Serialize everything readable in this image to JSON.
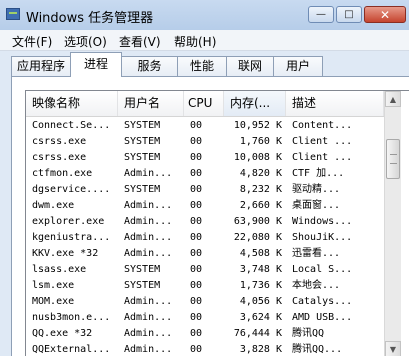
{
  "window": {
    "title": "Windows 任务管理器",
    "buttons": {
      "minimize": "—",
      "maximize": "□",
      "close": "✕"
    }
  },
  "menu": [
    "文件(F)",
    "选项(O)",
    "查看(V)",
    "帮助(H)"
  ],
  "tabs": [
    "应用程序",
    "进程",
    "服务",
    "性能",
    "联网",
    "用户"
  ],
  "active_tab": "进程",
  "columns": [
    "映像名称",
    "用户名",
    "CPU",
    "内存(...",
    "描述"
  ],
  "processes": [
    {
      "name": "Connect.Se...",
      "user": "SYSTEM",
      "cpu": "00",
      "mem": "10,952 K",
      "desc": "Content..."
    },
    {
      "name": "csrss.exe",
      "user": "SYSTEM",
      "cpu": "00",
      "mem": "1,760 K",
      "desc": "Client ..."
    },
    {
      "name": "csrss.exe",
      "user": "SYSTEM",
      "cpu": "00",
      "mem": "10,008 K",
      "desc": "Client ..."
    },
    {
      "name": "ctfmon.exe",
      "user": "Admin...",
      "cpu": "00",
      "mem": "4,820 K",
      "desc": "CTF 加..."
    },
    {
      "name": "dgservice....",
      "user": "SYSTEM",
      "cpu": "00",
      "mem": "8,232 K",
      "desc": "驱动精..."
    },
    {
      "name": "dwm.exe",
      "user": "Admin...",
      "cpu": "00",
      "mem": "2,660 K",
      "desc": "桌面窗..."
    },
    {
      "name": "explorer.exe",
      "user": "Admin...",
      "cpu": "00",
      "mem": "63,900 K",
      "desc": "Windows..."
    },
    {
      "name": "kgeniustra...",
      "user": "Admin...",
      "cpu": "00",
      "mem": "22,080 K",
      "desc": "ShouJiK..."
    },
    {
      "name": "KKV.exe *32",
      "user": "Admin...",
      "cpu": "00",
      "mem": "4,508 K",
      "desc": "迅雷看..."
    },
    {
      "name": "lsass.exe",
      "user": "SYSTEM",
      "cpu": "00",
      "mem": "3,748 K",
      "desc": "Local S..."
    },
    {
      "name": "lsm.exe",
      "user": "SYSTEM",
      "cpu": "00",
      "mem": "1,736 K",
      "desc": "本地会..."
    },
    {
      "name": "MOM.exe",
      "user": "Admin...",
      "cpu": "00",
      "mem": "4,056 K",
      "desc": "Catalys..."
    },
    {
      "name": "nusb3mon.e...",
      "user": "Admin...",
      "cpu": "00",
      "mem": "3,624 K",
      "desc": "AMD USB..."
    },
    {
      "name": "QQ.exe *32",
      "user": "Admin...",
      "cpu": "00",
      "mem": "76,444 K",
      "desc": "腾讯QQ"
    },
    {
      "name": "QQExternal...",
      "user": "Admin...",
      "cpu": "00",
      "mem": "3,828 K",
      "desc": "腾讯QQ..."
    }
  ],
  "icons": {
    "app": "task-manager-icon",
    "scroll_up": "scroll-up-arrow-icon",
    "scroll_down": "scroll-down-arrow-icon"
  }
}
